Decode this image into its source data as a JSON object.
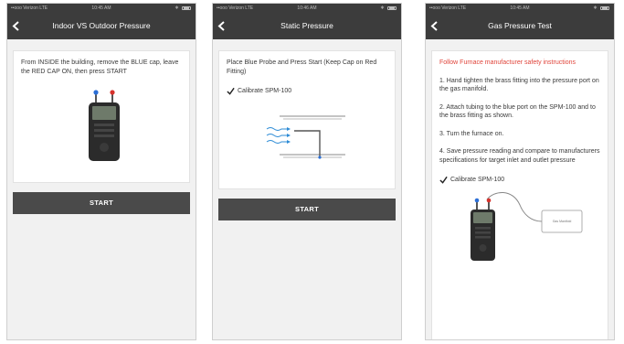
{
  "screens": [
    {
      "status": {
        "carrier": "••ooo Verizon  LTE",
        "time": "10:45 AM"
      },
      "title": "Indoor VS Outdoor Pressure",
      "instruction": "From INSIDE the building, remove the BLUE cap, leave the RED CAP ON, then press START",
      "start_label": "START"
    },
    {
      "status": {
        "carrier": "••ooo Verizon  LTE",
        "time": "10:46 AM"
      },
      "title": "Static Pressure",
      "instruction": "Place Blue Probe and Press Start (Keep Cap on Red Fitting)",
      "calibrate_label": "Calibrate SPM-100",
      "start_label": "START"
    },
    {
      "status": {
        "carrier": "••ooo Verizon  LTE",
        "time": "10:45 AM"
      },
      "title": "Gas Pressure Test",
      "warning": "Follow Furnace manufacturer safety instructions",
      "steps": [
        "1. Hand tighten the brass fitting into the pressure port on the gas manifold.",
        "2. Attach tubing to the blue port on the SPM-100 and to the brass fitting as shown.",
        "3. Turn the furnace on.",
        "4. Save pressure reading and compare to manufacturers specifications for target inlet and outlet pressure"
      ],
      "calibrate_label": "Calibrate SPM-100",
      "manifold_label": "Gas Manifold"
    }
  ],
  "colors": {
    "bar": "#3c3c3c",
    "button": "#4a4a4a",
    "warning": "#e0443a",
    "probe_blue": "#2c6fd6",
    "probe_red": "#d6322c"
  },
  "icons": {
    "back": "chevron-left-icon",
    "check": "checkmark-icon",
    "battery": "battery-icon"
  }
}
